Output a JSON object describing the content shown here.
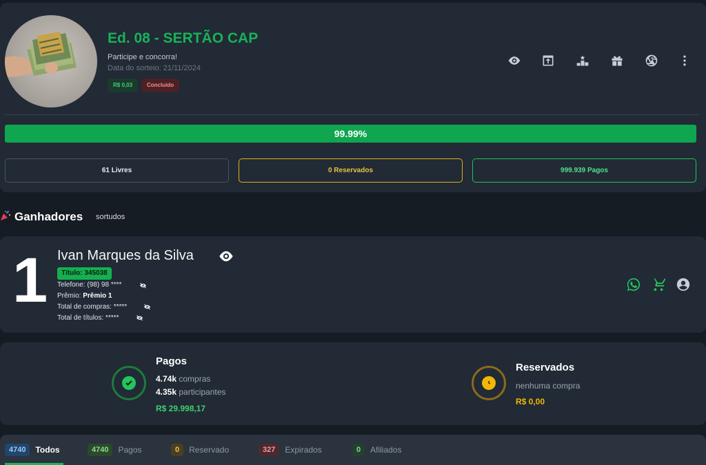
{
  "raffle": {
    "title": "Ed. 08 - SERTÃO CAP",
    "subtitle": "Participe e concorra!",
    "draw_date": "Data do sorteio: 21/11/2024",
    "price_badge": "R$ 0,03",
    "status_badge": "Concluído",
    "progress_label": "99.99%",
    "progress_percent": 99.99,
    "counts": {
      "livres": "61 Livres",
      "reservados": "0 Reservados",
      "pagos": "999.939 Pagos"
    },
    "actions": [
      "eye-icon",
      "open-in-new-icon",
      "podium-icon",
      "gift-icon",
      "aperture-icon",
      "more-vert-icon"
    ]
  },
  "winners": {
    "title": "Ganhadores",
    "subtitle": "sortudos",
    "items": [
      {
        "rank": "1",
        "name": "Ivan Marques da Silva",
        "ticket": "Título: 345038",
        "phone_label": "Telefone:",
        "phone_value": "(98) 98 ****",
        "prize_label": "Prêmio:",
        "prize_value": "Prêmio 1",
        "purchases_label": "Total de compras:",
        "purchases_value": "*****",
        "titles_label": "Total de títulos:",
        "titles_value": "*****"
      }
    ]
  },
  "stats": {
    "paid": {
      "title": "Pagos",
      "purchases_value": "4.74k",
      "purchases_label": "compras",
      "participants_value": "4.35k",
      "participants_label": "participantes",
      "amount": "R$ 29.998,17",
      "color": "#22c55e"
    },
    "reserved": {
      "title": "Reservados",
      "empty_text": "nenhuma compra",
      "amount": "R$ 0,00",
      "color": "#f2b705"
    }
  },
  "tabs": [
    {
      "count": "4740",
      "label": "Todos",
      "active": true
    },
    {
      "count": "4740",
      "label": "Pagos"
    },
    {
      "count": "0",
      "label": "Reservado"
    },
    {
      "count": "327",
      "label": "Expirados"
    },
    {
      "count": "0",
      "label": "Afiliados"
    }
  ]
}
